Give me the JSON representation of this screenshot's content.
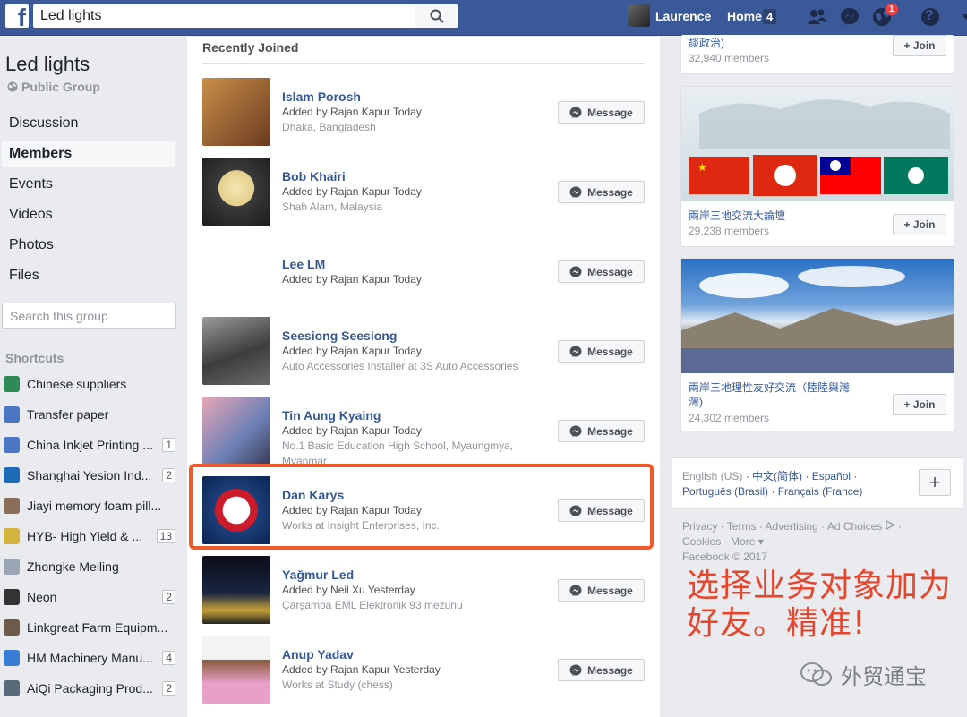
{
  "topbar": {
    "search_value": "Led lights",
    "user_name": "Laurence",
    "home_label": "Home",
    "home_count": "4",
    "notification_count": "1",
    "help_label": "?"
  },
  "group": {
    "title": "Led lights",
    "type": "Public Group"
  },
  "nav": [
    "Discussion",
    "Members",
    "Events",
    "Videos",
    "Photos",
    "Files"
  ],
  "group_search_placeholder": "Search this group",
  "shortcuts_title": "Shortcuts",
  "shortcuts": [
    {
      "label": "Chinese suppliers",
      "count": "",
      "color": "#2e8b57"
    },
    {
      "label": "Transfer paper",
      "count": "",
      "color": "#4a76c4"
    },
    {
      "label": "China Inkjet Printing ...",
      "count": "1",
      "color": "#4a76c4"
    },
    {
      "label": "Shanghai Yesion Ind...",
      "count": "2",
      "color": "#1e6bb8"
    },
    {
      "label": "Jiayi memory foam pill...",
      "count": "",
      "color": "#8a6d5a"
    },
    {
      "label": "HYB- High Yield & ...",
      "count": "13",
      "color": "#d4b23c"
    },
    {
      "label": "Zhongke Meiling",
      "count": "",
      "color": "#9aa5b5"
    },
    {
      "label": "Neon",
      "count": "2",
      "color": "#333333"
    },
    {
      "label": "Linkgreat Farm Equipm...",
      "count": "",
      "color": "#6b5b4b"
    },
    {
      "label": "HM Machinery Manu...",
      "count": "4",
      "color": "#3a7bd5"
    },
    {
      "label": "AiQi Packaging Prod...",
      "count": "2",
      "color": "#5a6a7a"
    }
  ],
  "members_title": "Recently Joined",
  "message_label": "Message",
  "members": [
    {
      "name": "Islam Porosh",
      "added": "Added by Rajan Kapur Today",
      "details": [
        "Dhaka, Bangladesh"
      ],
      "photo": "linear-gradient(135deg,#c98f4a,#6b3a1f)"
    },
    {
      "name": "Bob Khairi",
      "added": "Added by Rajan Kapur Today",
      "details": [
        "Shah Alam, Malaysia"
      ],
      "photo": "radial-gradient(circle at 50% 45%,#f7e7b0 0,#e2cf8e 35%,#3a3a3a 36%,#1c1c1c 100%)"
    },
    {
      "name": "Lee LM",
      "added": "Added by Rajan Kapur Today",
      "details": [],
      "photo": "#ffffff"
    },
    {
      "name": "Seesiong Seesiong",
      "added": "Added by Rajan Kapur Today",
      "details": [
        "Auto Accessories Installer at 3S Auto Accessories"
      ],
      "photo": "linear-gradient(160deg,#9a9a9a,#3d3d3d 55%,#6a6a6a)"
    },
    {
      "name": "Tin Aung Kyaing",
      "added": "Added by Rajan Kapur Today",
      "details": [
        "No.1 Basic Education High School, Myaungmya,",
        "Myanmar"
      ],
      "photo": "linear-gradient(135deg,#e8a7b7,#6b7fb5 60%,#3a3a55)"
    },
    {
      "name": "Dan Karys",
      "added": "Added by Rajan Kapur Today",
      "details": [
        "Works at Insight Enterprises, Inc."
      ],
      "photo": "radial-gradient(circle,#ffffff 0,#ffffff 28%,#cc1b2b 29%,#cc1b2b 44%,#1c3f7a 45%,#0b2452 100%)"
    },
    {
      "name": "Yağmur Led",
      "added": "Added by Neil Xu Yesterday",
      "details": [
        "Çarşamba EML Elektronik 93 mezunu"
      ],
      "photo": "linear-gradient(180deg,#0b0e1a,#1a2540 55%,#c7a23a 80%,#222 100%)"
    },
    {
      "name": "Anup Yadav",
      "added": "Added by Rajan Kapur Yesterday",
      "details": [
        "Works at Study (chess)"
      ],
      "photo": "linear-gradient(180deg,#f4f4f4,#f4f4f4 35%,#8a5a3a 36%,#e8a0c8 70%)"
    }
  ],
  "recommendations": [
    {
      "name": "談政治)",
      "members": "32,940 members"
    },
    {
      "name": "兩岸三地交流大論壇",
      "members": "29,238 members"
    },
    {
      "name": "兩岸三地理性友好交流（陸陸與灣灣)",
      "members": "24,302 members"
    }
  ],
  "join_label": "+ Join",
  "languages": {
    "current": "English (US)",
    "others": [
      "中文(简体)",
      "Español",
      "Português (Brasil)",
      "Français (France)"
    ],
    "plus": "+"
  },
  "footer": {
    "links": [
      "Privacy",
      "Terms",
      "Advertising",
      "Ad Choices",
      "Cookies",
      "More"
    ],
    "copyright": "Facebook © 2017"
  },
  "overlay": {
    "line1": "选择业务对象加为",
    "line2": "好友。精准!",
    "color": "#e8432b"
  },
  "watermark": "外贸通宝",
  "colors": {
    "brand": "#3b5998",
    "link": "#365899",
    "highlight": "#f05a28"
  }
}
